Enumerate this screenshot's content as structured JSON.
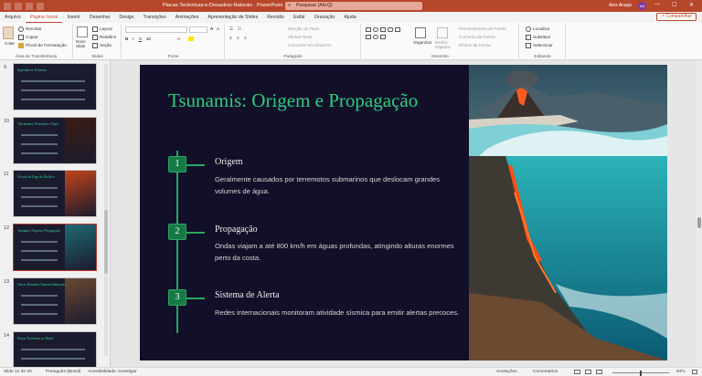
{
  "window": {
    "title": "Placas Tectonicas e Desastres Naturais  ·  Salvo neste PC  -  PowerPoint",
    "title_short": "Placas-Tectonicas-e-Desastres-Naturais  ·  PowerPoint",
    "search_placeholder": "Pesquisar (Alt+Q)",
    "user_name": "Alex Araujo",
    "user_initials": "AA",
    "controls": {
      "minimize": "—",
      "maximize": "☐",
      "close": "✕"
    }
  },
  "menu": {
    "tabs": [
      "Arquivo",
      "Página Inicial",
      "Inserir",
      "Desenhar",
      "Design",
      "Transições",
      "Animações",
      "Apresentação de Slides",
      "Revisão",
      "Exibir",
      "Gravação",
      "Ajuda"
    ],
    "active_index": 1,
    "share_label": "Compartilhar"
  },
  "ribbon": {
    "clipboard": {
      "paste": "Colar",
      "cut": "Recortar",
      "copy": "Copiar",
      "format_painter": "Pincel de Formatação",
      "label": "Área de Transferência"
    },
    "slides": {
      "new_slide": "Novo Slide",
      "layout": "Layout",
      "reset": "Redefinir",
      "section": "Seção",
      "label": "Slides"
    },
    "font": {
      "label": "Fonte"
    },
    "paragraph": {
      "text_direction": "Direção do Texto",
      "align_text": "Alinhar Texto",
      "smartart": "Converter em SmartArt",
      "label": "Parágrafo"
    },
    "drawing": {
      "arrange": "Organizar",
      "quick_styles": "Estilos Rápidos",
      "shape_fill": "Preenchimento da Forma",
      "shape_outline": "Contorno da Forma",
      "shape_effects": "Efeitos da Forma",
      "label": "Desenho"
    },
    "editing": {
      "find": "Localizar",
      "replace": "Substituir",
      "select": "Selecionar",
      "label": "Editando"
    }
  },
  "thumbnails": [
    {
      "number": "9",
      "title": "Importância Tectonica"
    },
    {
      "number": "10",
      "title": "Vulcanismo: Formação e Tipos"
    },
    {
      "number": "11",
      "title": "Círculo de Fogo do Pacífico"
    },
    {
      "number": "12",
      "title": "Tsunamis: Origem e Propagação"
    },
    {
      "number": "13",
      "title": "Outros Desastres Naturais Relacionados"
    },
    {
      "number": "14",
      "title": "Placas Tectônicas no Brasil"
    }
  ],
  "active_thumbnail": "12",
  "slide": {
    "title": "Tsunamis: Origem e Propagação",
    "items": [
      {
        "number": "1",
        "heading": "Origem",
        "text": "Geralmente causados por terremotos submarinos que deslocam grandes volumes de água."
      },
      {
        "number": "2",
        "heading": "Propagação",
        "text": "Ondas viajam a até 800 km/h em águas profundas, atingindo alturas enormes perto da costa."
      },
      {
        "number": "3",
        "heading": "Sistema de Alerta",
        "text": "Redes internacionais monitoram atividade sísmica para emitir alertas precoces."
      }
    ]
  },
  "status": {
    "slide_counter": "Slide 12 de 20",
    "language": "Português (Brasil)",
    "accessibility": "Acessibilidade: investigar",
    "notes": "Anotações",
    "comments": "Comentários",
    "zoom": "94%"
  },
  "colors": {
    "accent": "#b7472a",
    "slide_bg": "#111028",
    "title_green": "#2ecc80",
    "node_green": "#157a45"
  }
}
